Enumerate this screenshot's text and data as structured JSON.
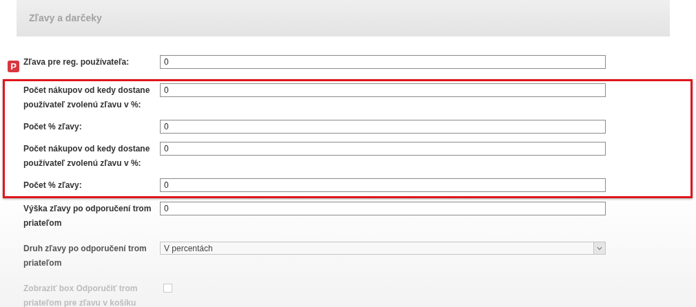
{
  "section_title": "Zľavy a darčeky",
  "fields": [
    {
      "kind": "text",
      "badge": "P",
      "label": "Zľava pre reg. používateľa:",
      "value": "0",
      "highlighted": false,
      "disabled": false
    },
    {
      "kind": "text",
      "label": "Počet nákupov od kedy dostane používateľ zvolenú zľavu v %:",
      "value": "0",
      "highlighted": true,
      "disabled": false
    },
    {
      "kind": "text",
      "label": "Počet % zľavy:",
      "value": "0",
      "highlighted": true,
      "disabled": false
    },
    {
      "kind": "text",
      "label": "Počet nákupov od kedy dostane používateľ zvolenú zľavu v %:",
      "value": "0",
      "highlighted": true,
      "disabled": false
    },
    {
      "kind": "text",
      "label": "Počet % zľavy:",
      "value": "0",
      "highlighted": true,
      "disabled": false
    },
    {
      "kind": "text",
      "label": "Výška zľavy po odporučení trom priateľom",
      "value": "0",
      "highlighted": false,
      "disabled": false
    },
    {
      "kind": "select",
      "label": "Druh zľavy po odporučení trom priateľom",
      "value": "V percentách",
      "highlighted": false,
      "disabled": false
    },
    {
      "kind": "checkbox",
      "label": "Zobraziť box Odporučiť trom priateľom pre zľavu v košíku",
      "checked": false,
      "highlighted": false,
      "disabled": true
    }
  ]
}
